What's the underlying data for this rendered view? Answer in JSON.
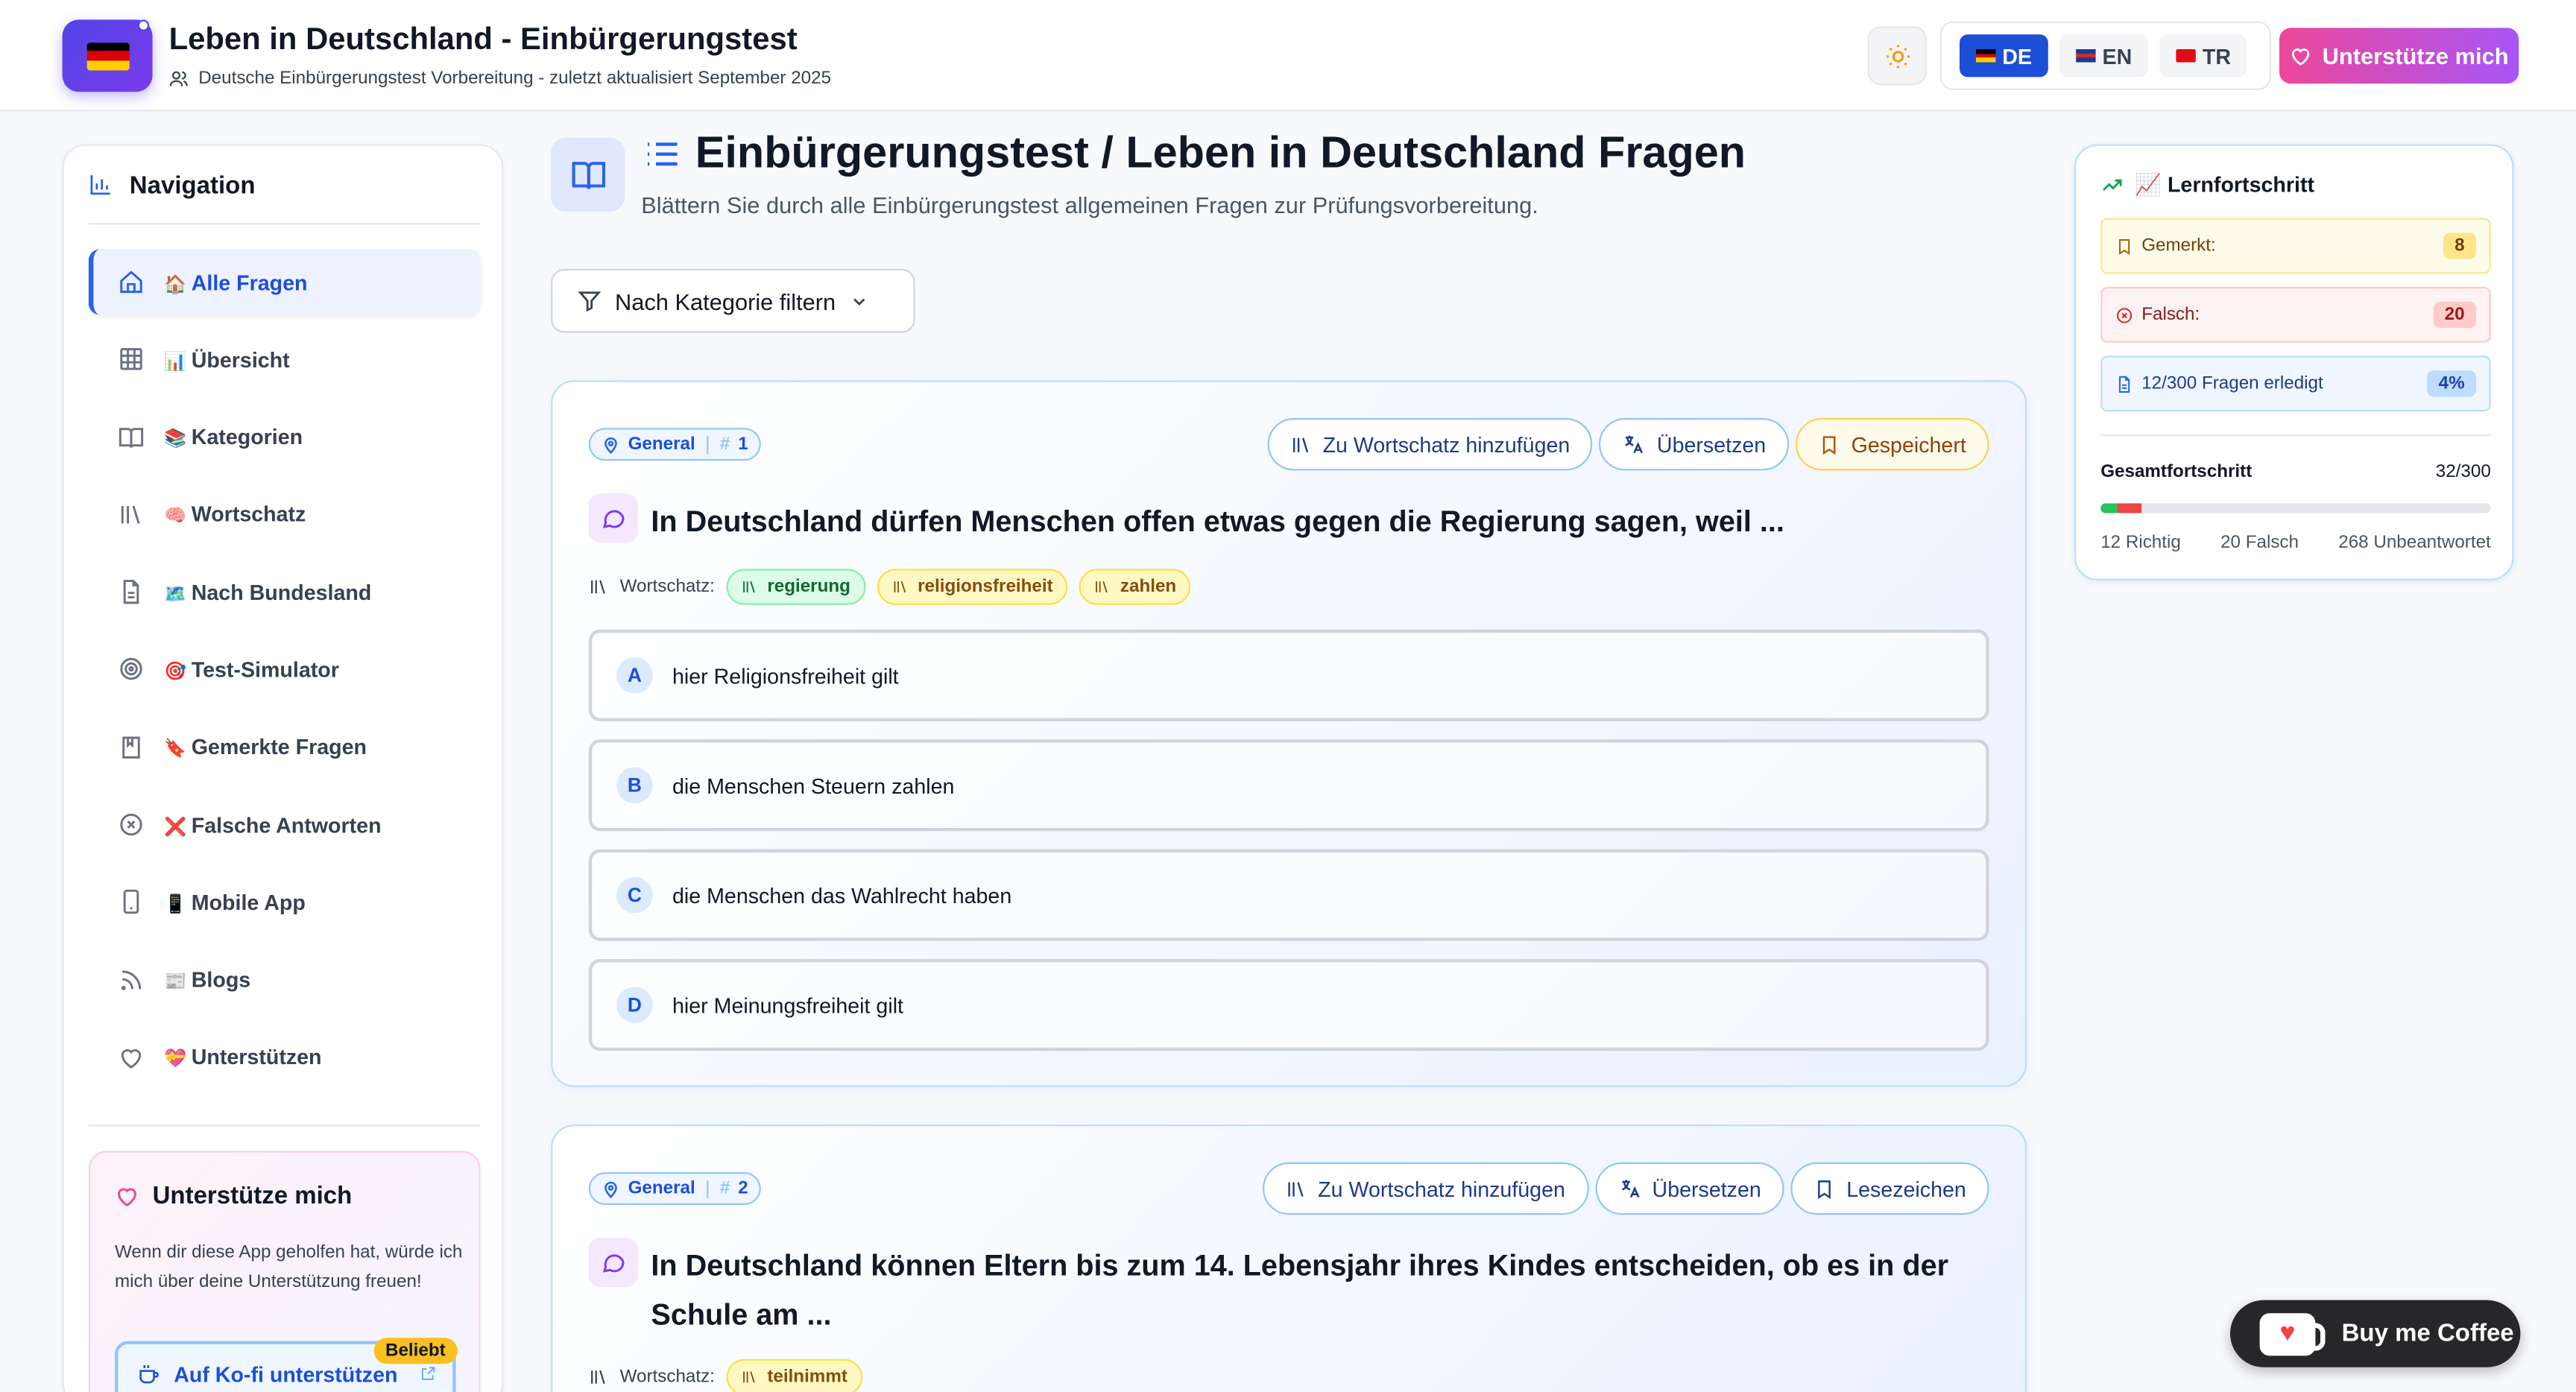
{
  "header": {
    "title": "Leben in Deutschland - Einbürgerungstest",
    "subtitle": "Deutsche Einbürgerungstest Vorbereitung - zuletzt aktualisiert September 2025",
    "languages": [
      {
        "code": "DE",
        "flag": "de"
      },
      {
        "code": "EN",
        "flag": "gb"
      },
      {
        "code": "TR",
        "flag": "tr"
      }
    ],
    "support_label": "Unterstütze mich"
  },
  "sidebar": {
    "heading": "Navigation",
    "items": [
      {
        "emoji": "🏠",
        "label": "Alle Fragen",
        "icon": "home-icon"
      },
      {
        "emoji": "📊",
        "label": "Übersicht",
        "icon": "grid-icon"
      },
      {
        "emoji": "📚",
        "label": "Kategorien",
        "icon": "book-open-icon"
      },
      {
        "emoji": "🧠",
        "label": "Wortschatz",
        "icon": "library-icon"
      },
      {
        "emoji": "🗺️",
        "label": "Nach Bundesland",
        "icon": "file-icon"
      },
      {
        "emoji": "🎯",
        "label": "Test-Simulator",
        "icon": "target-icon"
      },
      {
        "emoji": "🔖",
        "label": "Gemerkte Fragen",
        "icon": "bookmark-icon"
      },
      {
        "emoji": "❌",
        "label": "Falsche Antworten",
        "icon": "x-circle-icon"
      },
      {
        "emoji": "📱",
        "label": "Mobile App",
        "icon": "smartphone-icon"
      },
      {
        "emoji": "📰",
        "label": "Blogs",
        "icon": "rss-icon"
      },
      {
        "emoji": "💝",
        "label": "Unterstützen",
        "icon": "heart-icon"
      }
    ],
    "support_card": {
      "title": "Unterstütze mich",
      "text": "Wenn dir diese App geholfen hat, würde ich mich über deine Unterstützung freuen!",
      "kofi_label": "Auf Ko-fi unterstützen",
      "badge": "Beliebt"
    }
  },
  "main": {
    "title": "Einbürgerungstest / Leben in Deutschland Fragen",
    "subtitle": "Blättern Sie durch alle Einbürgerungstest allgemeinen Fragen zur Prüfungsvorbereitung.",
    "filter_label": "Nach Kategorie filtern",
    "vocab_label": "Wortschatz:",
    "questions": [
      {
        "category": "General",
        "number": "1",
        "actions": [
          "Zu Wortschatz hinzufügen",
          "Übersetzen",
          "Gespeichert"
        ],
        "text": "In Deutschland dürfen Menschen offen etwas gegen die Regierung sagen, weil ...",
        "vocab": [
          {
            "word": "regierung",
            "color": "green"
          },
          {
            "word": "religionsfreiheit",
            "color": "yellow"
          },
          {
            "word": "zahlen",
            "color": "yellow"
          }
        ],
        "answers": [
          {
            "letter": "A",
            "text": "hier Religionsfreiheit gilt"
          },
          {
            "letter": "B",
            "text": "die Menschen Steuern zahlen"
          },
          {
            "letter": "C",
            "text": "die Menschen das Wahlrecht haben"
          },
          {
            "letter": "D",
            "text": "hier Meinungsfreiheit gilt"
          }
        ]
      },
      {
        "category": "General",
        "number": "2",
        "actions": [
          "Zu Wortschatz hinzufügen",
          "Übersetzen",
          "Lesezeichen"
        ],
        "text": "In Deutschland können Eltern bis zum 14. Lebensjahr ihres Kindes entscheiden, ob es in der Schule am ...",
        "vocab": [
          {
            "word": "teilnimmt",
            "color": "yellow"
          }
        ]
      }
    ]
  },
  "progress": {
    "heading": "📈 Lernfortschritt",
    "bookmarked_label": "Gemerkt:",
    "bookmarked_value": "8",
    "wrong_label": "Falsch:",
    "wrong_value": "20",
    "done_label": "12/300 Fragen erledigt",
    "done_value": "4%",
    "overall_label": "Gesamtfortschritt",
    "overall_value": "32/300",
    "correct_count": 12,
    "wrong_count": 20,
    "total": 300,
    "legend_correct": "12 Richtig",
    "legend_wrong": "20 Falsch",
    "legend_unanswered": "268 Unbeantwortet"
  },
  "coffee": {
    "label": "Buy me Coffee"
  },
  "colors": {
    "accent": "#2563eb",
    "brand_gradient_start": "#ec4899",
    "brand_gradient_end": "#a855f7"
  }
}
